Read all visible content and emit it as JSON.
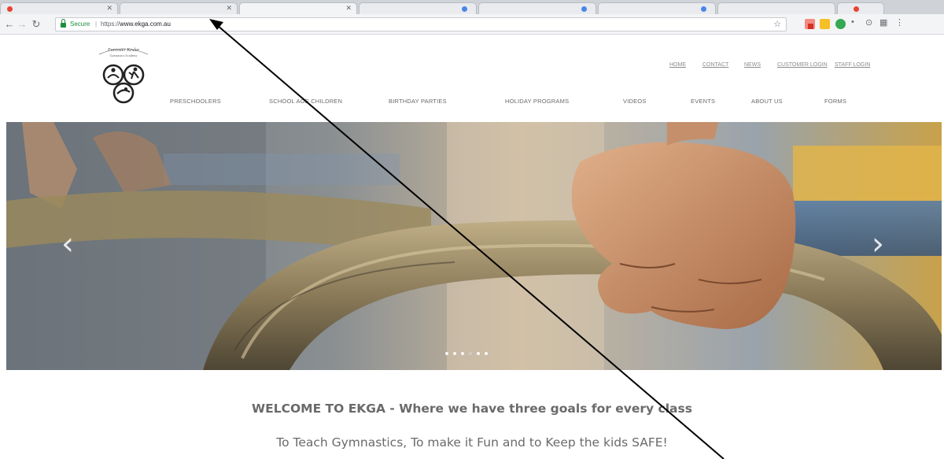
{
  "browser": {
    "omnibox": {
      "secure_label": "Secure",
      "separator": "|",
      "url_scheme": "https://",
      "url_host": "www.ekga.com.au"
    },
    "icons": {
      "back": "back-arrow-icon",
      "forward": "forward-arrow-icon",
      "reload": "reload-icon",
      "star": "bookmark-star-icon",
      "menu": "more-menu-icon"
    }
  },
  "site": {
    "logo_text": "Forrester Kesler Gymnastics Academy",
    "top_nav": [
      "HOME",
      "CONTACT",
      "NEWS",
      "CUSTOMER LOGIN",
      "STAFF LOGIN"
    ],
    "main_nav": [
      "PRESCHOOLERS",
      "SCHOOL AGE CHILDREN",
      "BIRTHDAY PARTIES",
      "HOLIDAY PROGRAMS",
      "VIDEOS",
      "EVENTS",
      "ABOUT US",
      "FORMS"
    ],
    "carousel": {
      "prev_label": "‹",
      "next_label": "›",
      "slide_count": 6,
      "active_slide": 4
    },
    "welcome_title": "WELCOME TO EKGA - Where we have three goals for every class",
    "welcome_sub": "To Teach Gymnastics, To make it Fun and to Keep the kids SAFE!"
  },
  "colors": {
    "secure_green": "#1e8e3e",
    "nav_text": "#6a6a6a",
    "annotation": "#000000"
  }
}
